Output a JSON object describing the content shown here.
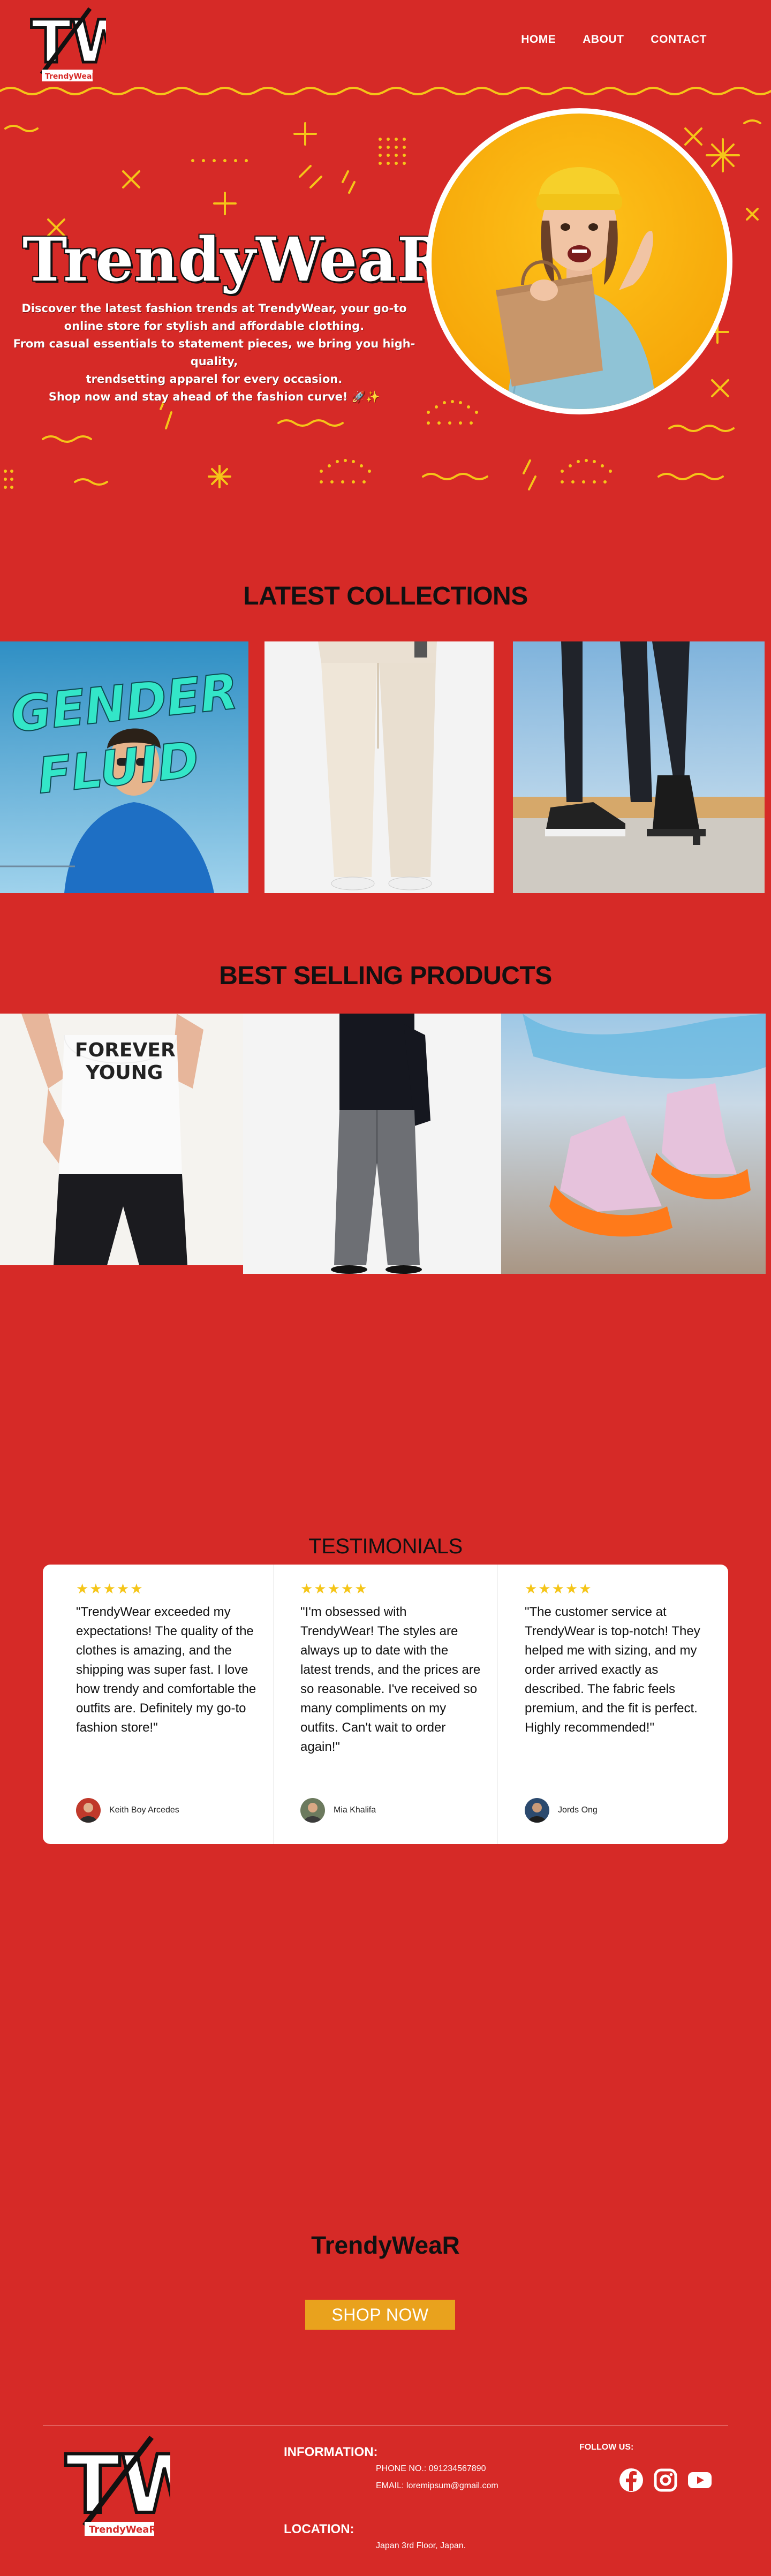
{
  "brand": {
    "logo_text": "TW",
    "logo_subtext": "TrendyWeaR",
    "name": "TrendyWeaR"
  },
  "nav": {
    "items": [
      {
        "label": "HOME"
      },
      {
        "label": "ABOUT"
      },
      {
        "label": "CONTACT"
      }
    ]
  },
  "hero": {
    "title": "TrendyWeaR",
    "line1": "Discover the latest fashion trends at TrendyWear, your go-to",
    "line2": "online store for stylish and affordable clothing.",
    "line3": "From casual essentials to statement pieces, we bring you high-quality,",
    "line4": "trendsetting apparel for every occasion.",
    "line5": "Shop now and stay ahead of the fashion curve! 🚀✨"
  },
  "collections": {
    "title": "LATEST COLLECTIONS",
    "items": [
      {
        "image": "gender-fluid-jacket-photo",
        "overlay_text": "GENDER FLUID"
      },
      {
        "image": "cream-pants-photo"
      },
      {
        "image": "boots-and-sneakers-photo"
      }
    ]
  },
  "best_selling": {
    "title": "BEST SELLING PRODUCTS",
    "items": [
      {
        "image": "forever-young-tank-photo",
        "shirt_text_1": "FOREVER",
        "shirt_text_2": "YOUNG"
      },
      {
        "image": "grey-trousers-photo"
      },
      {
        "image": "orange-sneakers-photo"
      }
    ]
  },
  "testimonials": {
    "title": "TESTIMONIALS",
    "stars": "★★★★★",
    "items": [
      {
        "quote": "\"TrendyWear exceeded my expectations! The quality of the clothes is amazing, and the shipping was super fast. I love how trendy and comfortable the outfits are. Definitely my go-to fashion store!\"",
        "author": "Keith Boy Arcedes"
      },
      {
        "quote": "\"I'm obsessed with TrendyWear! The styles are always up to date with the latest trends, and the prices are so reasonable. I've received so many compliments on my outfits. Can't wait to order again!\"",
        "author": "Mia Khalifa"
      },
      {
        "quote": "\"The customer service at TrendyWear is top-notch! They helped me with sizing, and my order arrived exactly as described. The fabric feels premium, and the fit is perfect. Highly recommended!\"",
        "author": "Jords Ong"
      }
    ]
  },
  "cta": {
    "brand": "TrendyWeaR",
    "button_label": "SHOP NOW"
  },
  "footer": {
    "information_label": "INFORMATION:",
    "phone": "PHONE NO.: 091234567890",
    "email": "EMAIL: loremipsum@gmail.com",
    "location_label": "LOCATION:",
    "address": "Japan 3rd Floor, Japan.",
    "follow_label": "FOLLOW US:",
    "social": [
      "facebook-icon",
      "instagram-icon",
      "youtube-icon"
    ]
  },
  "colors": {
    "background": "#d62a27",
    "accent_yellow": "#f5c518",
    "button": "#e9a21d"
  }
}
